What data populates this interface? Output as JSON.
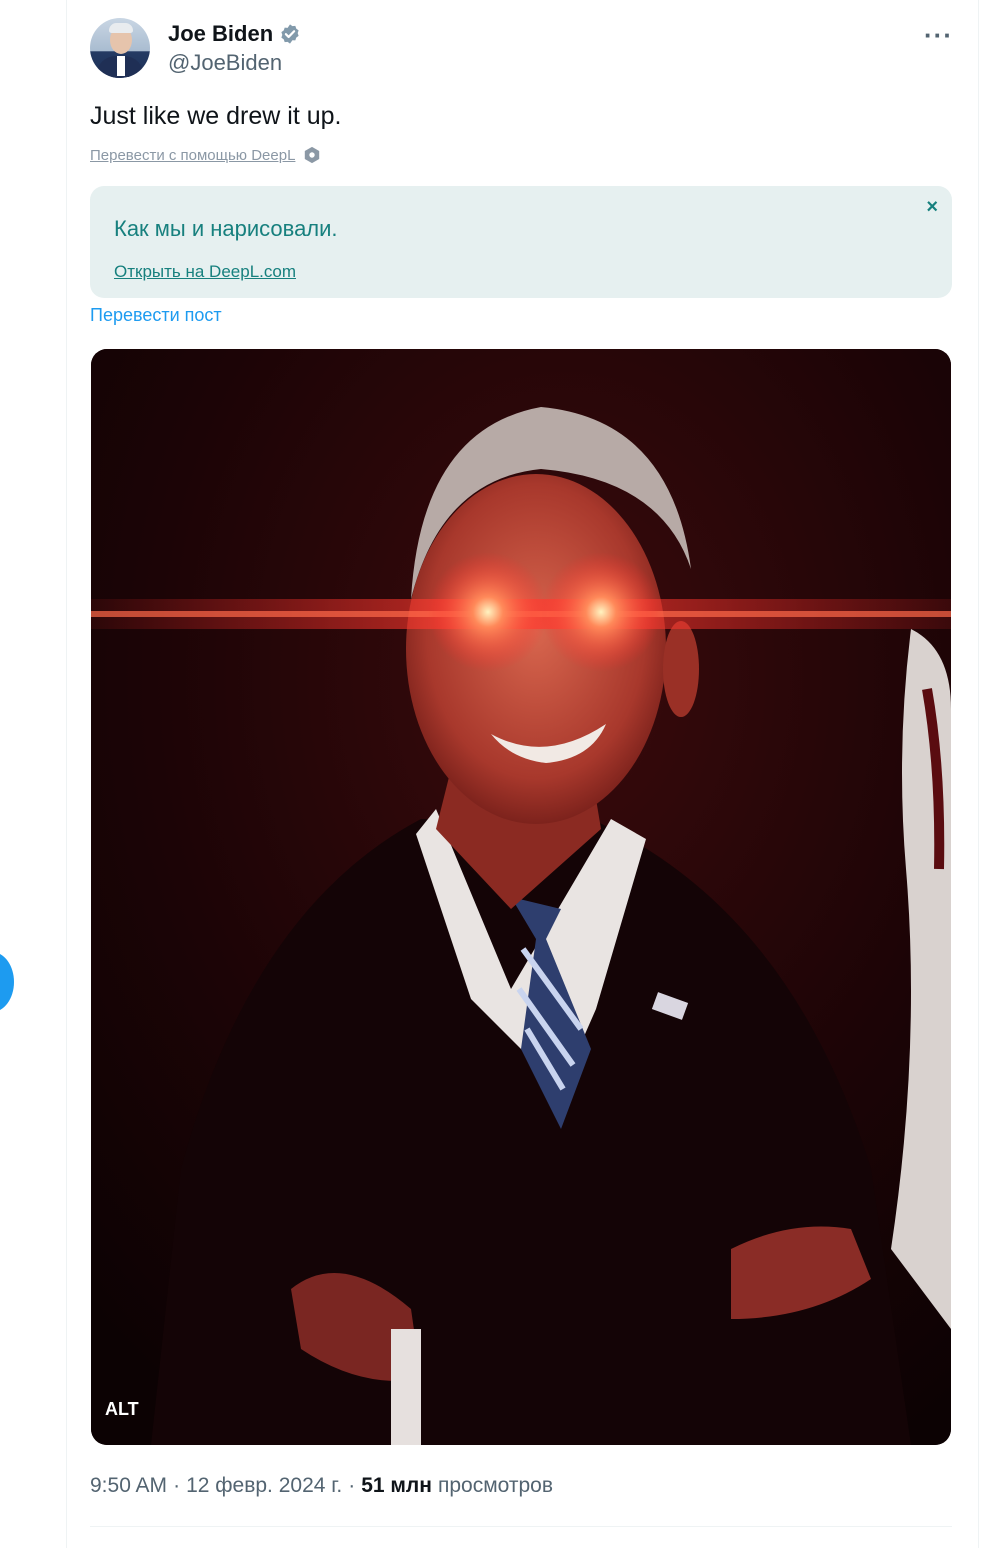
{
  "author": {
    "name": "Joe Biden",
    "handle": "@JoeBiden"
  },
  "tweet": {
    "text": "Just like we drew it up.",
    "deepl_translate_link": "Перевести с помощью DeepL"
  },
  "translation": {
    "text": "Как мы и нарисовали.",
    "open_link": "Открыть на DeepL.com",
    "close_symbol": "×"
  },
  "translate_post_link": "Перевести пост",
  "media": {
    "alt_badge": "ALT"
  },
  "meta": {
    "time": "9:50 AM",
    "separator": "·",
    "date": "12 февр. 2024 г.",
    "separator2": "·",
    "views_count": "51 млн",
    "views_label": "просмотров"
  },
  "more_symbol": "···",
  "colors": {
    "link_blue": "#1d9bf0",
    "deepl_teal": "#17807e",
    "translation_bg": "#e6f0f0",
    "verified_gray": "#829aab"
  }
}
